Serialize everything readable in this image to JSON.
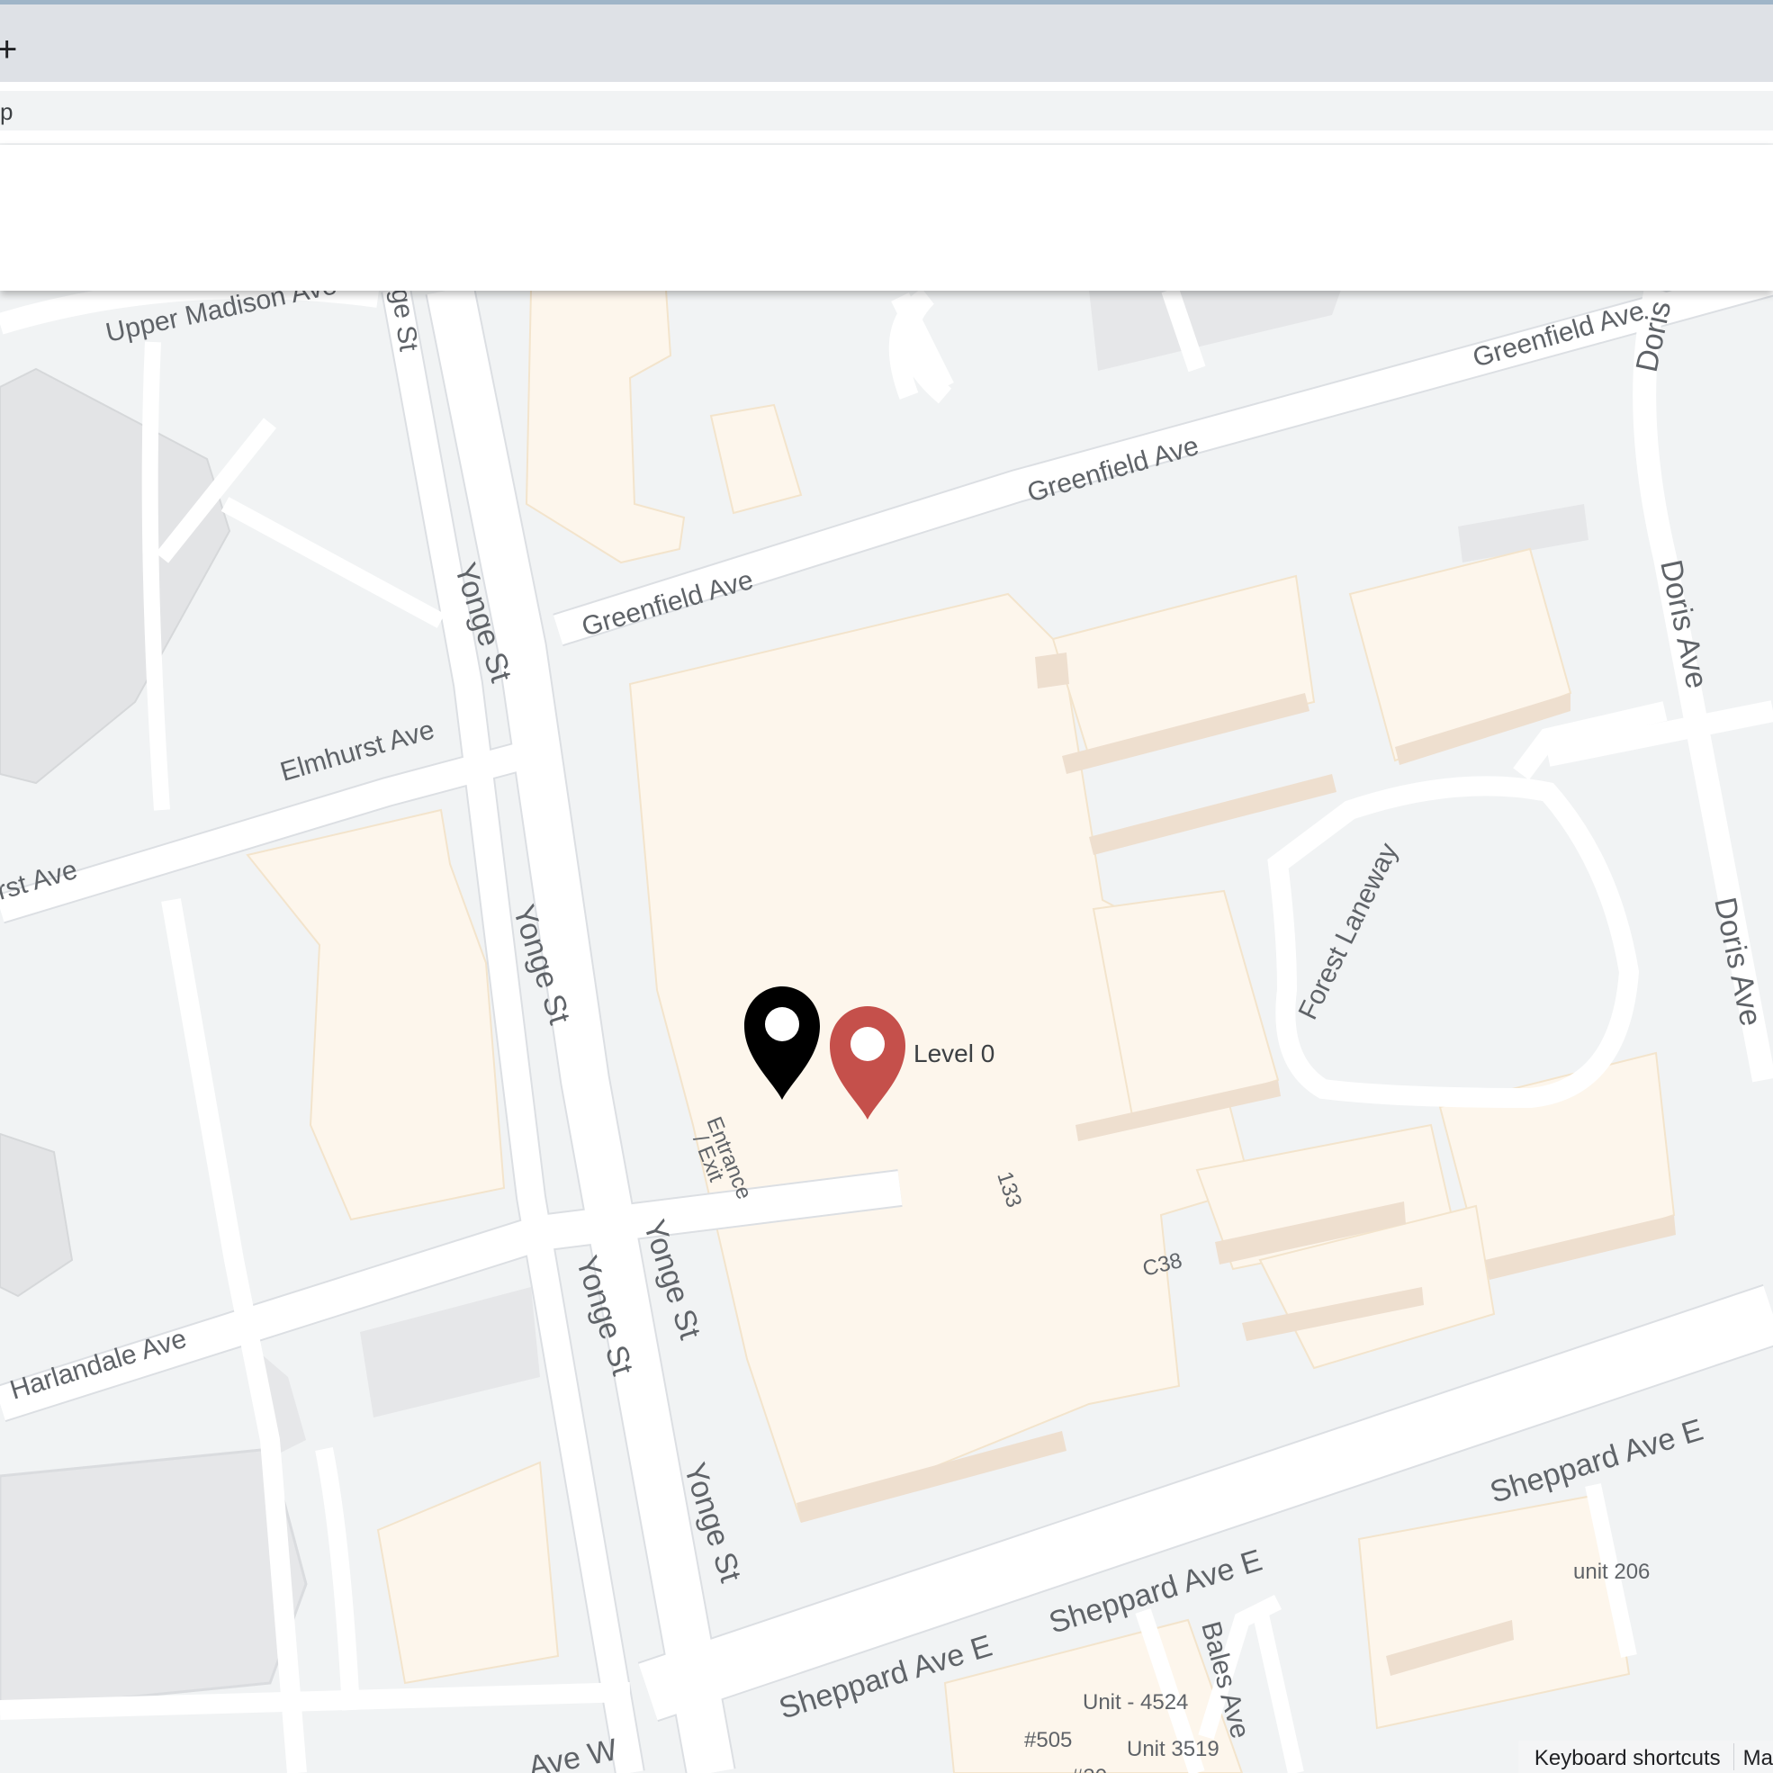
{
  "browser": {
    "new_tab_icon": "plus-icon",
    "address_text": "p"
  },
  "map": {
    "streets": {
      "upper_madison": "Upper Madison Ave",
      "yonge_partial": "ge St",
      "yonge": "Yonge St",
      "greenfield": "Greenfield Ave",
      "doris_partial": "Doris",
      "doris": "Doris Ave",
      "elmhurst": "Elmhurst Ave",
      "elmhurst_partial": "rst Ave",
      "forest_laneway": "Forest Laneway",
      "harlandale": "Harlandale Ave",
      "sheppard": "Sheppard Ave E",
      "bales": "Bales Ave",
      "sheppard_w_partial": "Ave W"
    },
    "places": {
      "entrance_line1": "Entrance",
      "entrance_line2": "/ Exit",
      "unit_133": "133",
      "unit_c38": "C38",
      "unit_206": "unit 206",
      "unit_4524": "Unit - 4524",
      "unit_505": "#505",
      "unit_3519": "Unit 3519",
      "unit_partial": "#30"
    },
    "markers": {
      "black_marker_icon": "map-pin-icon",
      "red_marker_icon": "map-pin-icon",
      "red_marker_label": "Level 0"
    },
    "colors": {
      "background": "#f1f3f4",
      "road": "#ffffff",
      "building": "#fdf6ec",
      "building_shadow": "#eedfcf",
      "red_marker": "#c5504b",
      "black_marker": "#000000"
    }
  },
  "footer": {
    "keyboard_shortcuts": "Keyboard shortcuts",
    "map_data_partial": "Ma"
  }
}
